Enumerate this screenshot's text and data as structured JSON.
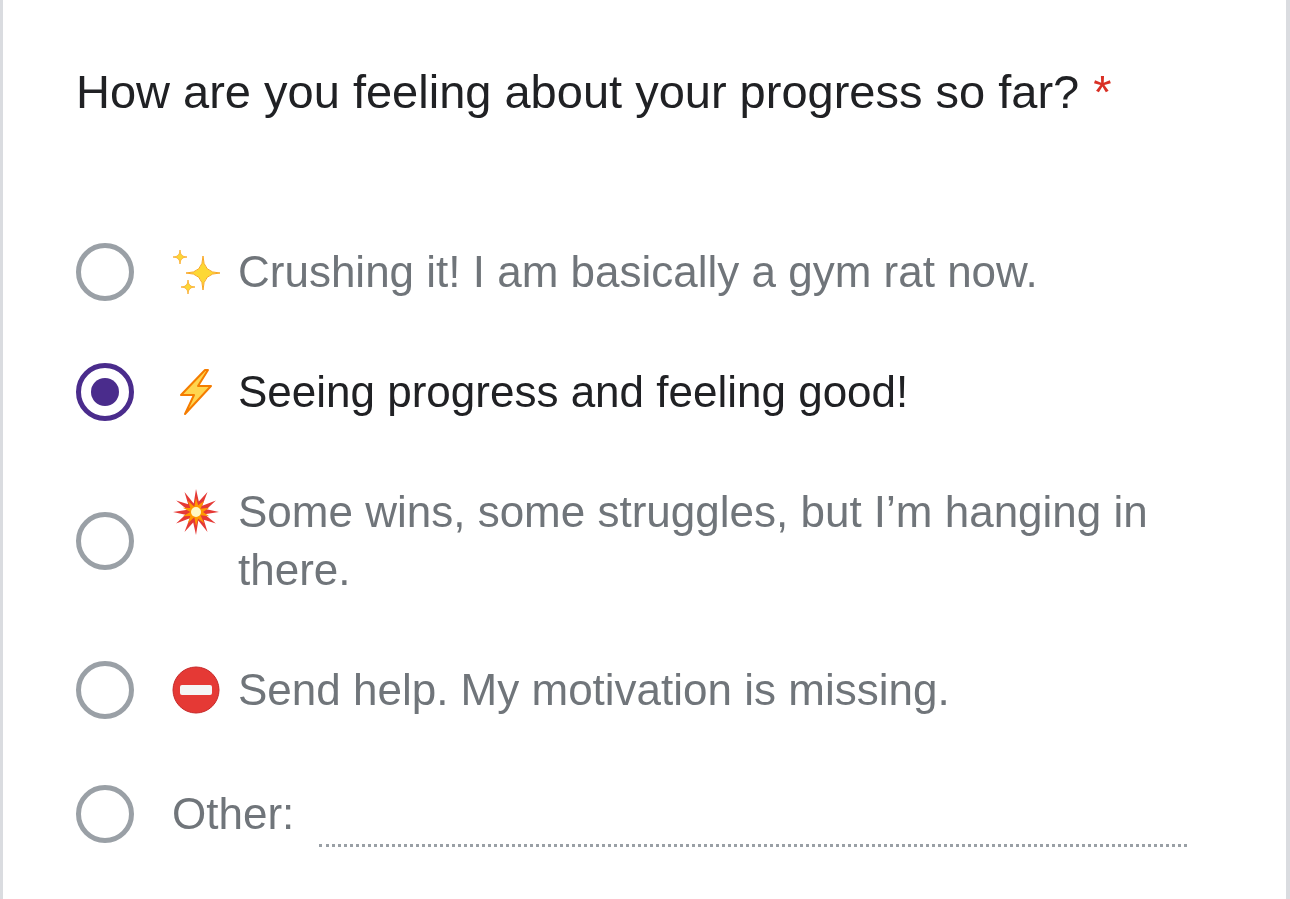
{
  "question": {
    "title": "How are you feeling about your progress so far?",
    "required_mark": "*"
  },
  "options": [
    {
      "kind": "sparkles",
      "label": "Crushing it! I am basically a gym rat now.",
      "selected": false
    },
    {
      "kind": "lightning",
      "label": "Seeing progress and feeling good!",
      "selected": true
    },
    {
      "kind": "explosion",
      "label": "Some wins, some struggles, but I’m hanging in there.",
      "selected": false
    },
    {
      "kind": "noentry",
      "label": "Send help. My motivation is missing.",
      "selected": false
    },
    {
      "kind": "other",
      "label": "Other:",
      "selected": false
    }
  ]
}
